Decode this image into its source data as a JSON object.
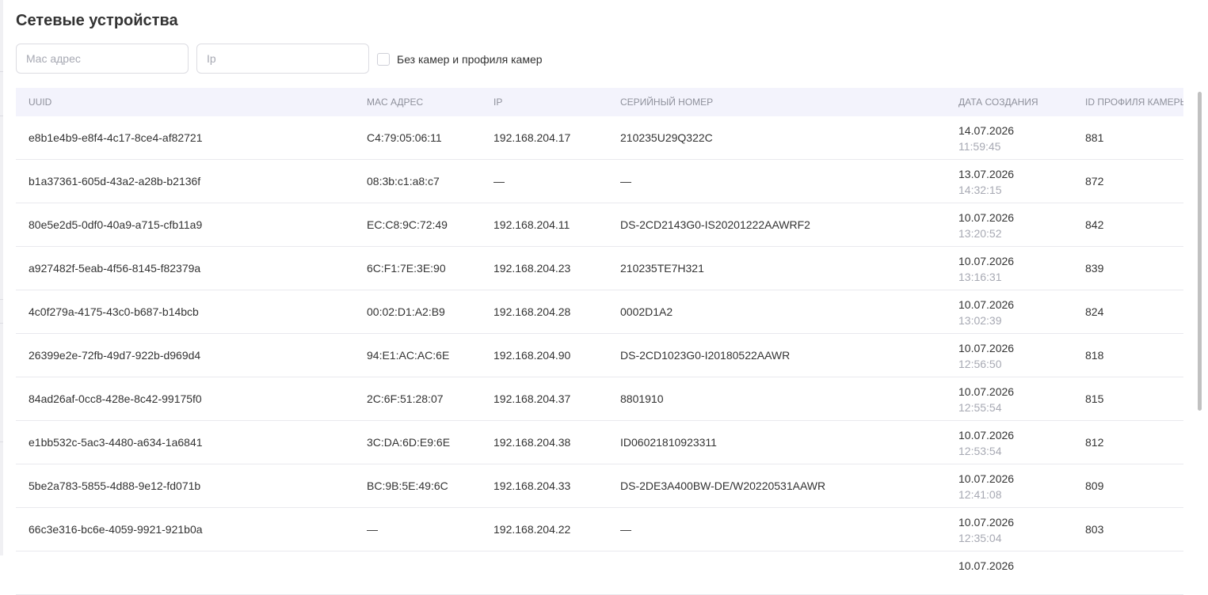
{
  "page": {
    "title": "Сетевые устройства"
  },
  "filters": {
    "mac_placeholder": "Mac адрес",
    "ip_placeholder": "Ip",
    "no_cameras_label": "Без камер и профиля камер",
    "no_cameras_checked": false
  },
  "table": {
    "columns": {
      "uuid": "UUID",
      "mac": "MAC АДРЕС",
      "ip": "IP",
      "serial": "СЕРИЙНЫЙ НОМЕР",
      "created": "ДАТА СОЗДАНИЯ",
      "profile": "ID ПРОФИЛЯ КАМЕРЫ"
    },
    "rows": [
      {
        "uuid": "e8b1e4b9-e8f4-4c17-8ce4-af82721",
        "mac": "C4:79:05:06:11",
        "ip": "192.168.204.17",
        "serial": "210235U29Q322C",
        "date": "14.07.2026",
        "time": "11:59:45",
        "profile": "881"
      },
      {
        "uuid": "b1a37361-605d-43a2-a28b-b2136f",
        "mac": "08:3b:c1:a8:c7",
        "ip": "—",
        "serial": "—",
        "date": "13.07.2026",
        "time": "14:32:15",
        "profile": "872"
      },
      {
        "uuid": "80e5e2d5-0df0-40a9-a715-cfb11a9",
        "mac": "EC:C8:9C:72:49",
        "ip": "192.168.204.11",
        "serial": "DS-2CD2143G0-IS20201222AAWRF2",
        "date": "10.07.2026",
        "time": "13:20:52",
        "profile": "842"
      },
      {
        "uuid": "a927482f-5eab-4f56-8145-f82379a",
        "mac": "6C:F1:7E:3E:90",
        "ip": "192.168.204.23",
        "serial": "210235TE7H321",
        "date": "10.07.2026",
        "time": "13:16:31",
        "profile": "839"
      },
      {
        "uuid": "4c0f279a-4175-43c0-b687-b14bcb",
        "mac": "00:02:D1:A2:B9",
        "ip": "192.168.204.28",
        "serial": "0002D1A2",
        "date": "10.07.2026",
        "time": "13:02:39",
        "profile": "824"
      },
      {
        "uuid": "26399e2e-72fb-49d7-922b-d969d4",
        "mac": "94:E1:AC:AC:6E",
        "ip": "192.168.204.90",
        "serial": "DS-2CD1023G0-I20180522AAWR",
        "date": "10.07.2026",
        "time": "12:56:50",
        "profile": "818"
      },
      {
        "uuid": "84ad26af-0cc8-428e-8c42-99175f0",
        "mac": "2C:6F:51:28:07",
        "ip": "192.168.204.37",
        "serial": "8801910",
        "date": "10.07.2026",
        "time": "12:55:54",
        "profile": "815"
      },
      {
        "uuid": "e1bb532c-5ac3-4480-a634-1a6841",
        "mac": "3C:DA:6D:E9:6E",
        "ip": "192.168.204.38",
        "serial": "ID06021810923311",
        "date": "10.07.2026",
        "time": "12:53:54",
        "profile": "812"
      },
      {
        "uuid": "5be2a783-5855-4d88-9e12-fd071b",
        "mac": "BC:9B:5E:49:6C",
        "ip": "192.168.204.33",
        "serial": "DS-2DE3A400BW-DE/W20220531AAWR",
        "date": "10.07.2026",
        "time": "12:41:08",
        "profile": "809"
      },
      {
        "uuid": "66c3e316-bc6e-4059-9921-921b0a",
        "mac": "—",
        "ip": "192.168.204.22",
        "serial": "—",
        "date": "10.07.2026",
        "time": "12:35:04",
        "profile": "803"
      },
      {
        "uuid": "",
        "mac": "",
        "ip": "",
        "serial": "",
        "date": "10.07.2026",
        "time": "",
        "profile": ""
      }
    ]
  }
}
